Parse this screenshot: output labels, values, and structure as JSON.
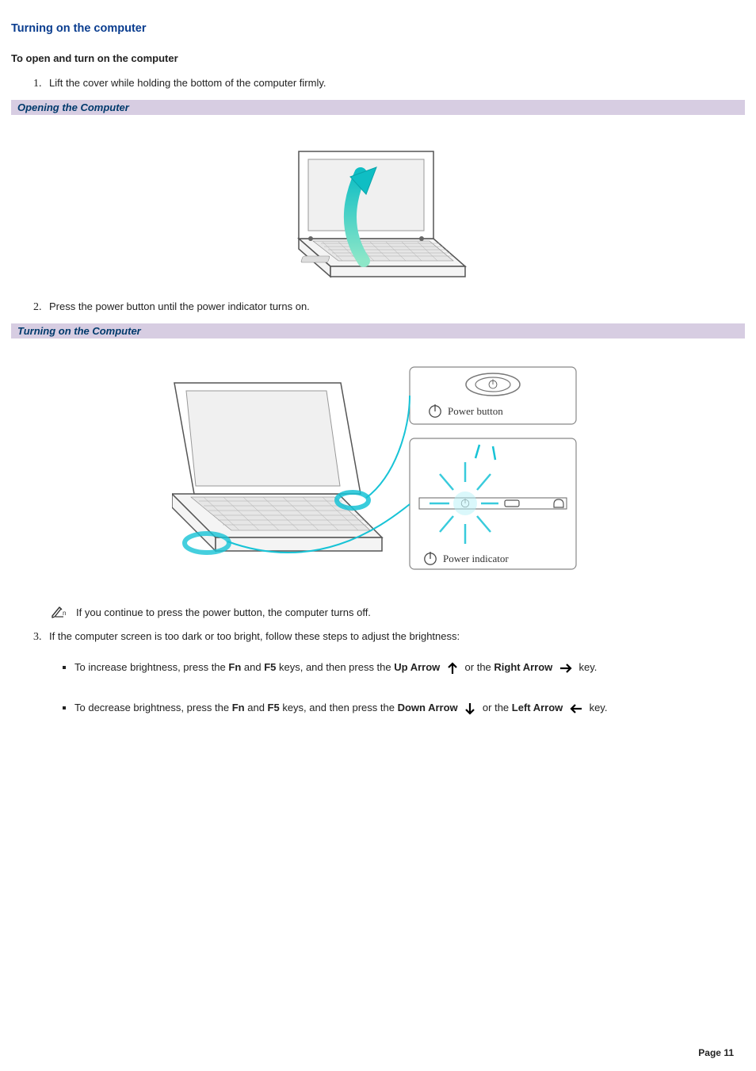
{
  "title": "Turning on the computer",
  "subhead": "To open and turn on the computer",
  "steps": {
    "s1": "Lift the cover while holding the bottom of the computer firmly.",
    "s2": "Press the power button until the power indicator turns on.",
    "s3": "If the computer screen is too dark or too bright, follow these steps to adjust the brightness:"
  },
  "captions": {
    "opening": "Opening the Computer",
    "turning_on": "Turning on the Computer"
  },
  "fig_labels": {
    "power_button": "Power button",
    "power_indicator": "Power indicator"
  },
  "note": "If you continue to press the power button, the computer turns off.",
  "bullets": {
    "inc": {
      "pre": "To increase brightness, press the ",
      "fn": "Fn",
      "and": " and ",
      "f5": "F5",
      "mid": " keys, and then press the ",
      "up": "Up Arrow",
      "or": " or the ",
      "right": "Right Arrow",
      "post": " key."
    },
    "dec": {
      "pre": "To decrease brightness, press the ",
      "fn": "Fn",
      "and": " and ",
      "f5": "F5",
      "mid": " keys, and then press the ",
      "down": "Down Arrow",
      "or": " or the ",
      "left": "Left Arrow",
      "post": " key."
    }
  },
  "page_number": "Page 11"
}
